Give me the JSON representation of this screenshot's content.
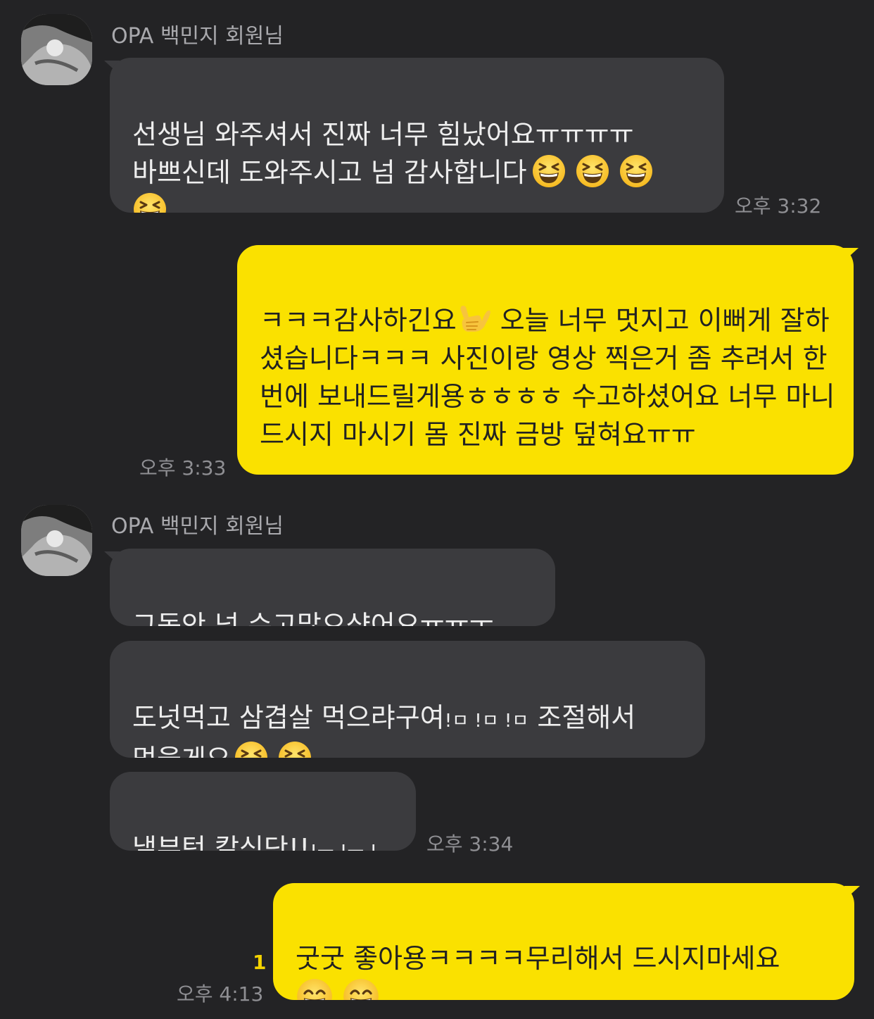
{
  "chat": {
    "sender_name": "OPA 백민지 회원님",
    "messages": {
      "m1_text": "선생님 와주셔서 진짜 너무 힘났어요ㅠㅠㅠㅠ\n바쁘신데 도와주시고 넘 감사합니다",
      "m1_emoji_1": "grinning-squinting-face",
      "m1_emoji_2": "grinning-squinting-face",
      "m1_emoji_3": "grinning-squinting-face",
      "m1_emoji_4": "grinning-squinting-face",
      "m1_time": "오후 3:32",
      "m2_text_a": "ㅋㅋㅋ감사하긴요",
      "m2_emoji": "call-me-hand",
      "m2_text_b": " 오늘 너무 멋지고 이뻐게 잘하셨습니다ㅋㅋㅋ 사진이랑 영상 찍은거 좀 추려서 한번에 보내드릴게용ㅎㅎㅎㅎ 수고하셨어요 너무 마니 드시지 마시기 몸 진짜 금방 덮혀요ㅠㅠ",
      "m2_time": "오후 3:33",
      "m3_text": "그동안 넘 수고많으샸어요ㅠㅠㅜ",
      "m4_text_a": "도넛먹고 삼겹살 먹으랴구여",
      "m4_exclaims": "!ㅁ !ㅁ !ㅁ",
      "m4_text_b": " 조절해서",
      "m4_text_c": "먹을게요",
      "m4_emoji_1": "grinning-squinting-face",
      "m4_emoji_2": "grinning-squinting-face",
      "m5_text_a": "낼부턴 칼식단!!",
      "m5_exclaims": "!ㅡ !ㅡ !ㅡ",
      "m5_time": "오후 3:34",
      "m6_text": "굿굿 좋아용ㅋㅋㅋㅋ무리해서 드시지마세요",
      "m6_emoji_1": "beaming-face",
      "m6_emoji_2": "beaming-face",
      "m6_unread": "1",
      "m6_time": "오후 4:13"
    }
  },
  "colors": {
    "background": "#232325",
    "incoming_bubble": "#3b3b3e",
    "outgoing_bubble": "#fae100",
    "timestamp": "#8f8f93",
    "unread_count": "#f4d300"
  }
}
